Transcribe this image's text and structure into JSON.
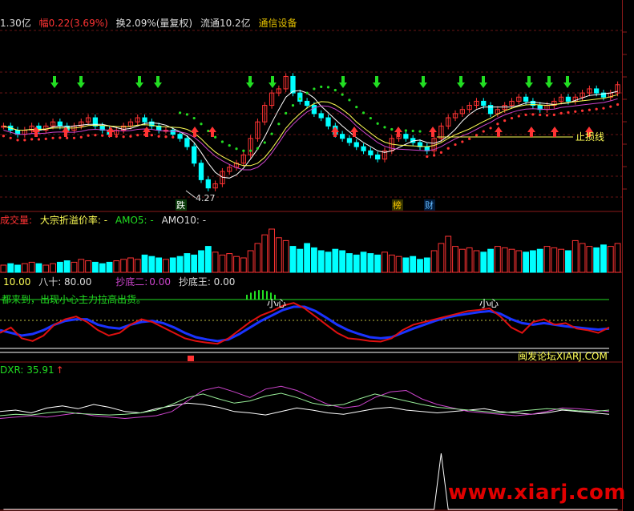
{
  "header": {
    "amount": "1.30亿",
    "change_label": "幅",
    "change_value": "0.22(3.69%)",
    "turnover": "换2.09%(量复权)",
    "float_cap": "流通10.2亿",
    "sector": "通信设备"
  },
  "main_panel": {
    "stop_loss_label": "止损线",
    "low_price_label": "4.27",
    "mark_die": "跌",
    "mark_bang": "榜",
    "mark_cai": "财"
  },
  "volume_panel": {
    "title": "成交量:",
    "premium": "大宗折溢价率: -",
    "amo5": "AMO5: -",
    "amo10": "AMO10: -"
  },
  "osc_panel": {
    "ten_label": "10.00",
    "eighty_label": "八十: 80.00",
    "bottom2_label": "抄底二:",
    "bottom2_value": "0.00",
    "bottom_king": "抄底王: 0.00",
    "note": "都来到，出现小心主力拉高出货。",
    "careful_1": "小心",
    "careful_2": "小心",
    "forum": "闽发论坛XIARJ.COM"
  },
  "dmi_panel": {
    "label": "DXR: 35.91",
    "arrow": "↑"
  },
  "watermark": "www.xiarj.com",
  "colors": {
    "up": "#ff3333",
    "down": "#00ffff",
    "green": "#22dd22",
    "yellow": "#ffff55",
    "magenta": "#cc44cc",
    "grid": "#8b1a1a"
  },
  "chart_data": [
    {
      "type": "candlestick",
      "title": "",
      "close": [
        5.05,
        5.0,
        4.95,
        5.0,
        5.05,
        5.0,
        5.05,
        5.1,
        5.05,
        5.0,
        5.05,
        5.1,
        5.15,
        5.05,
        5.0,
        4.95,
        5.0,
        5.05,
        5.1,
        5.15,
        5.1,
        5.05,
        5.0,
        5.0,
        4.95,
        4.9,
        4.8,
        4.6,
        4.4,
        4.3,
        4.35,
        4.5,
        4.55,
        4.6,
        4.7,
        4.9,
        5.1,
        5.3,
        5.45,
        5.5,
        5.65,
        5.45,
        5.35,
        5.3,
        5.2,
        5.15,
        5.05,
        4.95,
        4.9,
        4.85,
        4.8,
        4.75,
        4.7,
        4.65,
        4.75,
        4.9,
        4.95,
        4.9,
        4.85,
        4.8,
        4.75,
        4.9,
        5.05,
        5.15,
        5.2,
        5.25,
        5.3,
        5.35,
        5.3,
        5.2,
        5.25,
        5.3,
        5.35,
        5.4,
        5.35,
        5.3,
        5.25,
        5.3,
        5.35,
        5.4,
        5.35,
        5.4,
        5.45,
        5.5,
        5.45,
        5.4,
        5.45,
        5.55
      ],
      "annotations": [
        "止损线",
        "4.27",
        "跌",
        "榜",
        "财"
      ]
    },
    {
      "type": "bar",
      "title": "成交量",
      "values": [
        5,
        6,
        5,
        6,
        7,
        6,
        5,
        6,
        7,
        8,
        7,
        9,
        8,
        7,
        6,
        7,
        8,
        9,
        10,
        9,
        12,
        11,
        10,
        9,
        10,
        11,
        13,
        12,
        15,
        18,
        14,
        12,
        13,
        11,
        10,
        15,
        20,
        26,
        30,
        24,
        22,
        18,
        16,
        20,
        17,
        15,
        14,
        16,
        15,
        13,
        12,
        14,
        13,
        12,
        14,
        12,
        11,
        10,
        11,
        9,
        10,
        15,
        20,
        25,
        18,
        16,
        17,
        15,
        14,
        16,
        18,
        17,
        16,
        15,
        14,
        15,
        16,
        18,
        17,
        16,
        15,
        22,
        20,
        18,
        17,
        19,
        18,
        20
      ]
    },
    {
      "type": "line",
      "series": [
        {
          "name": "红线",
          "values": [
            30,
            40,
            20,
            15,
            25,
            45,
            55,
            60,
            50,
            35,
            25,
            30,
            45,
            55,
            50,
            40,
            30,
            20,
            15,
            12,
            10,
            20,
            35,
            50,
            62,
            70,
            80,
            85,
            75,
            60,
            45,
            30,
            20,
            18,
            15,
            14,
            20,
            35,
            45,
            50,
            55,
            60,
            65,
            70,
            72,
            75,
            60,
            40,
            30,
            50,
            55,
            45,
            48,
            38,
            35,
            30,
            40
          ]
        },
        {
          "name": "蓝线",
          "values": [
            35,
            30,
            25,
            28,
            35,
            45,
            52,
            55,
            55,
            45,
            40,
            38,
            45,
            50,
            52,
            48,
            40,
            30,
            22,
            18,
            15,
            18,
            28,
            40,
            52,
            62,
            72,
            78,
            78,
            70,
            58,
            45,
            35,
            28,
            22,
            20,
            22,
            30,
            38,
            45,
            52,
            58,
            62,
            65,
            68,
            70,
            65,
            55,
            48,
            45,
            48,
            45,
            42,
            40,
            38,
            36,
            38
          ]
        }
      ]
    },
    {
      "type": "line",
      "title": "DXR: 35.91",
      "series": [
        {
          "name": "白线",
          "values": [
            30,
            32,
            28,
            35,
            38,
            34,
            40,
            36,
            30,
            28,
            34,
            38,
            42,
            40,
            36,
            30,
            28,
            25,
            30,
            35,
            32,
            28,
            26,
            30,
            34,
            36,
            32,
            30,
            28,
            30,
            32,
            34,
            30,
            28,
            26,
            28,
            32,
            30,
            28,
            26
          ]
        },
        {
          "name": "紫线",
          "values": [
            20,
            22,
            24,
            22,
            25,
            28,
            24,
            22,
            20,
            22,
            24,
            30,
            45,
            60,
            65,
            58,
            50,
            62,
            66,
            60,
            50,
            40,
            35,
            38,
            50,
            58,
            60,
            48,
            40,
            35,
            30,
            28,
            26,
            24,
            26,
            30,
            35,
            34,
            32,
            30
          ]
        },
        {
          "name": "绿线",
          "values": [
            24,
            26,
            25,
            28,
            30,
            27,
            26,
            25,
            26,
            28,
            32,
            40,
            50,
            55,
            48,
            42,
            45,
            52,
            56,
            50,
            42,
            38,
            40,
            48,
            55,
            50,
            45,
            40,
            36,
            34,
            32,
            30,
            28,
            30,
            32,
            34,
            33,
            31,
            30,
            32
          ]
        }
      ]
    },
    {
      "type": "line",
      "values": [
        0,
        0,
        0,
        0,
        0,
        0,
        0,
        0,
        0,
        0,
        0,
        0,
        0,
        0,
        0,
        0,
        0,
        0,
        0,
        0,
        0,
        0,
        0,
        0,
        0,
        0,
        0,
        0,
        0,
        0,
        0,
        0,
        0,
        0,
        0,
        0,
        0,
        0,
        0,
        0,
        0,
        0,
        0,
        0,
        0,
        0,
        0,
        0,
        0,
        0,
        0,
        0,
        0,
        0,
        0,
        0,
        0,
        0,
        0,
        0,
        0,
        0,
        1,
        0,
        0,
        0,
        0,
        0,
        0,
        0,
        0,
        0,
        0,
        0,
        0,
        0,
        0,
        0,
        0,
        0,
        0,
        0,
        0,
        0,
        0,
        0,
        0,
        0
      ]
    }
  ]
}
